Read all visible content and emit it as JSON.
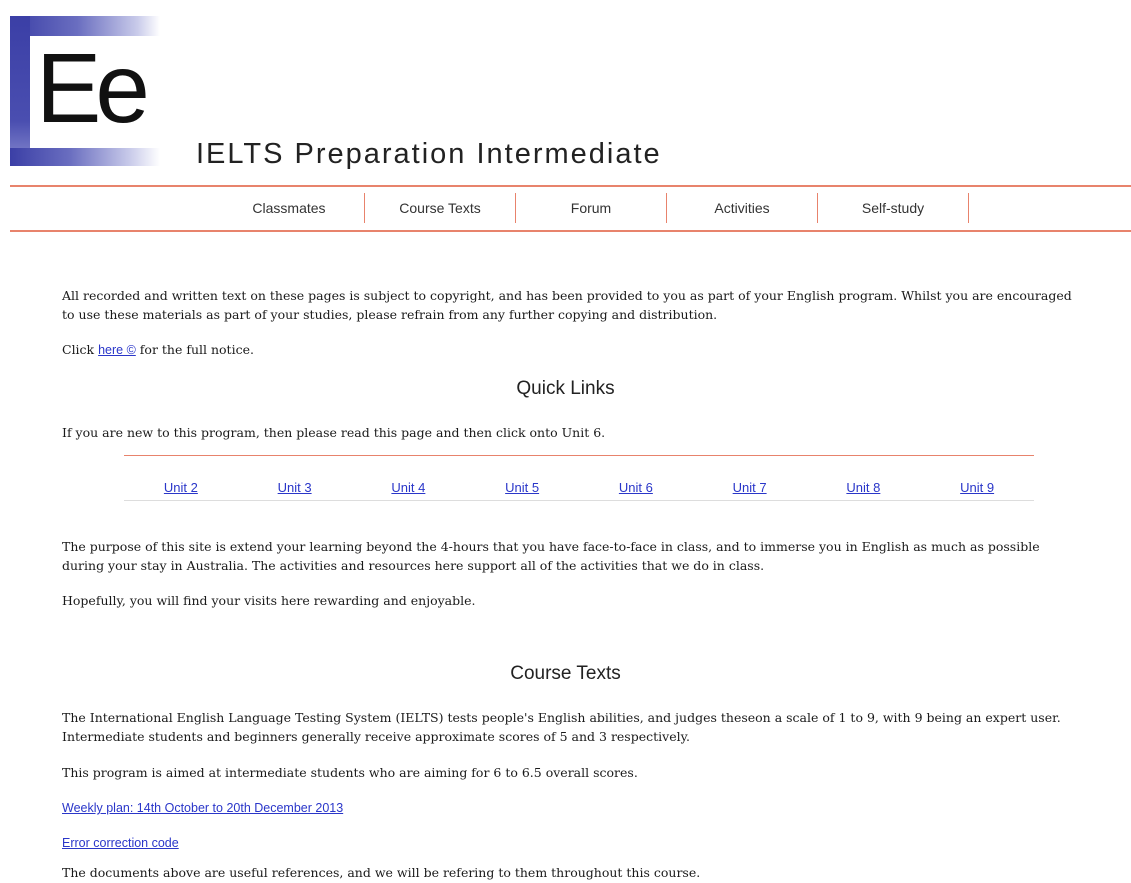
{
  "logo": {
    "letters": "Ee"
  },
  "site_title": "IELTS Preparation Intermediate",
  "nav": [
    "Classmates",
    "Course Texts",
    "Forum",
    "Activities",
    "Self-study"
  ],
  "copyright": {
    "line1": "All recorded and written text on these pages is subject to copyright, and has been provided to you as part of your English program. Whilst you are encouraged",
    "line2": "to use these materials as part of your studies, please refrain from any further copying and distribution.",
    "click_prefix": "Click ",
    "link": "here ©",
    "click_suffix": " for the full notice."
  },
  "quick_links": {
    "title": "Quick Links",
    "intro": "If you are new to this program, then please read this page and then click onto Unit 6.",
    "units": [
      "Unit 2",
      "Unit 3",
      "Unit 4",
      "Unit 5",
      "Unit 6",
      "Unit 7",
      "Unit 8",
      "Unit 9"
    ]
  },
  "purpose": {
    "line1": "The purpose of this site is extend your learning beyond the 4-hours that you have face-to-face in class, and to immerse you in English as much as possible",
    "line2": "during your stay in Australia. The activities and resources here support all of the activities that we do in class.",
    "hope": "Hopefully, you will find your visits here rewarding and enjoyable."
  },
  "course_texts": {
    "title": "Course Texts",
    "line1": "The International English Language Testing System (IELTS) tests people's English abilities, and judges theseon a scale of 1 to 9, with 9 being an expert user.",
    "line2": "Intermediate students and beginners generally receive approximate scores of 5 and 3 respectively.",
    "aim": "This program is aimed at intermediate students who are aiming for 6 to 6.5 overall scores.",
    "weekly_plan": "Weekly plan: 14th October to 20th December 2013",
    "error_code": "Error correction code",
    "footer": "The documents above are useful references, and we will be refering to them throughout this course."
  }
}
